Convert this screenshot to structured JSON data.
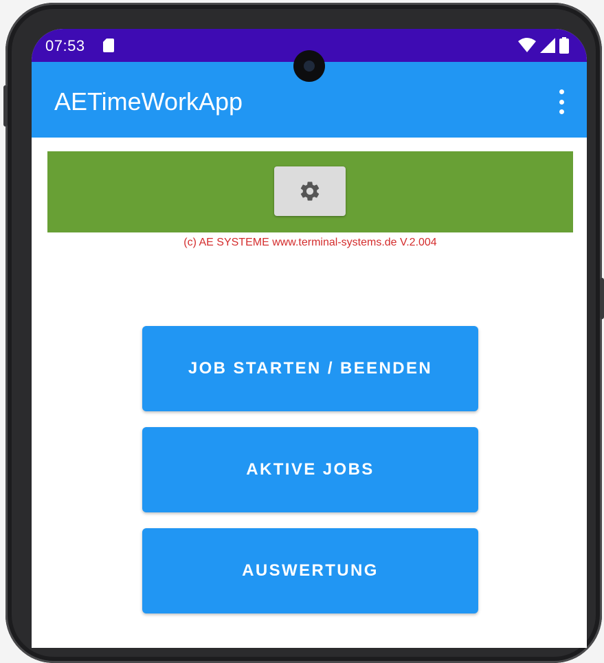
{
  "status_bar": {
    "time": "07:53",
    "icons": [
      "sd-card-icon",
      "wifi-icon",
      "signal-icon",
      "battery-icon"
    ]
  },
  "app_bar": {
    "title": "AETimeWorkApp",
    "menu_icon": "more-vert-icon"
  },
  "header_panel": {
    "settings_icon": "gear-icon",
    "copyright": "(c) AE SYSTEME www.terminal-systems.de V.2.004"
  },
  "buttons": [
    {
      "label": "JOB STARTEN / BEENDEN"
    },
    {
      "label": "AKTIVE JOBS"
    },
    {
      "label": "AUSWERTUNG"
    }
  ],
  "colors": {
    "status_bar": "#3e0bb3",
    "primary": "#2196f3",
    "panel_green": "#68a035",
    "copyright_red": "#d42c2c",
    "settings_button": "#dcdcdc"
  }
}
